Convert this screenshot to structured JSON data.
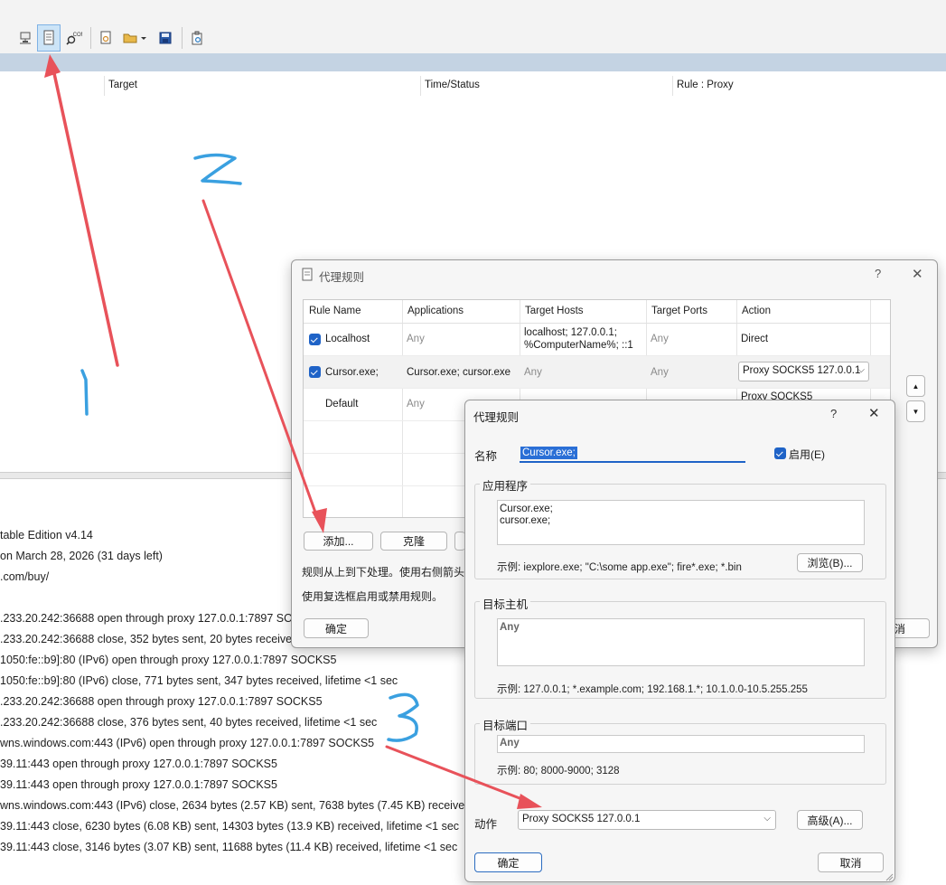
{
  "toolbar": {
    "icons": [
      "network-icon",
      "document-icon",
      "com-search-icon",
      "settings-doc-icon",
      "folder-open-icon",
      "save-icon",
      "clipboard-icon"
    ],
    "active_index": 1
  },
  "main_table": {
    "columns": [
      "Target",
      "Time/Status",
      "Rule : Proxy"
    ]
  },
  "log": {
    "lines": [
      "table Edition v4.14",
      "on March 28, 2026 (31 days left)",
      ".com/buy/",
      "",
      ".233.20.242:36688 open through proxy 127.0.0.1:7897 SOCKS5",
      ".233.20.242:36688 close, 352 bytes sent, 20 bytes received, lifetime <1 sec",
      "1050:fe::b9]:80 (IPv6) open through proxy 127.0.0.1:7897 SOCKS5",
      "1050:fe::b9]:80 (IPv6) close, 771 bytes sent, 347 bytes received, lifetime <1 sec",
      ".233.20.242:36688 open through proxy 127.0.0.1:7897 SOCKS5",
      ".233.20.242:36688 close, 376 bytes sent, 40 bytes received, lifetime <1 sec",
      "wns.windows.com:443 (IPv6) open through proxy 127.0.0.1:7897 SOCKS5",
      "39.11:443 open through proxy 127.0.0.1:7897 SOCKS5",
      "39.11:443 open through proxy 127.0.0.1:7897 SOCKS5",
      "wns.windows.com:443 (IPv6) close, 2634 bytes (2.57 KB) sent, 7638 bytes (7.45 KB) received",
      "39.11:443 close, 6230 bytes (6.08 KB) sent, 14303 bytes (13.9 KB) received, lifetime <1 sec",
      "39.11:443 close, 3146 bytes (3.07 KB) sent, 11688 bytes (11.4 KB) received, lifetime <1 sec"
    ]
  },
  "rules_dialog": {
    "title": "代理规则",
    "help": "?",
    "close": "✕",
    "columns": [
      "Rule Name",
      "Applications",
      "Target Hosts",
      "Target Ports",
      "Action"
    ],
    "rows": [
      {
        "name": "Localhost",
        "apps": "Any",
        "hosts_line1": "localhost; 127.0.0.1;",
        "hosts_line2": "%ComputerName%; ::1",
        "ports": "Any",
        "action": "Direct",
        "checked": true
      },
      {
        "name": "Cursor.exe;",
        "apps": "Cursor.exe; cursor.exe",
        "hosts": "Any",
        "ports": "Any",
        "action": "Proxy SOCKS5 127.0.0.1",
        "checked": true
      },
      {
        "name": "Default",
        "apps": "Any",
        "hosts": "",
        "ports": "",
        "action": "Proxy SOCKS5",
        "checked": false
      }
    ],
    "add_button": "添加...",
    "clone_button": "克隆",
    "info_line1": "规则从上到下处理。使用右侧箭头",
    "info_line2": "使用复选框启用或禁用规则。",
    "ok_button": "确定",
    "cancel_partial": "消"
  },
  "edit_dialog": {
    "title": "代理规则",
    "help": "?",
    "close": "✕",
    "name_label": "名称",
    "name_value": "Cursor.exe;",
    "enable_label": "启用(E)",
    "apps_group": "应用程序",
    "apps_line1": "Cursor.exe;",
    "apps_line2": "cursor.exe;",
    "apps_hint": "示例: iexplore.exe; \"C:\\some app.exe\"; fire*.exe; *.bin",
    "browse_button": "浏览(B)...",
    "hosts_group": "目标主机",
    "hosts_value": "Any",
    "hosts_hint": "示例: 127.0.0.1; *.example.com; 192.168.1.*; 10.1.0.0-10.5.255.255",
    "ports_group": "目标端口",
    "ports_value": "Any",
    "ports_hint": "示例: 80; 8000-9000; 3128",
    "action_label": "动作",
    "action_value": "Proxy SOCKS5 127.0.0.1",
    "advanced_button": "高级(A)...",
    "ok_button": "确定",
    "cancel_button": "取消"
  },
  "colors": {
    "annotation_arrow": "#e8525a",
    "annotation_digit": "#3aa0e0",
    "accent": "#1f63c7"
  }
}
